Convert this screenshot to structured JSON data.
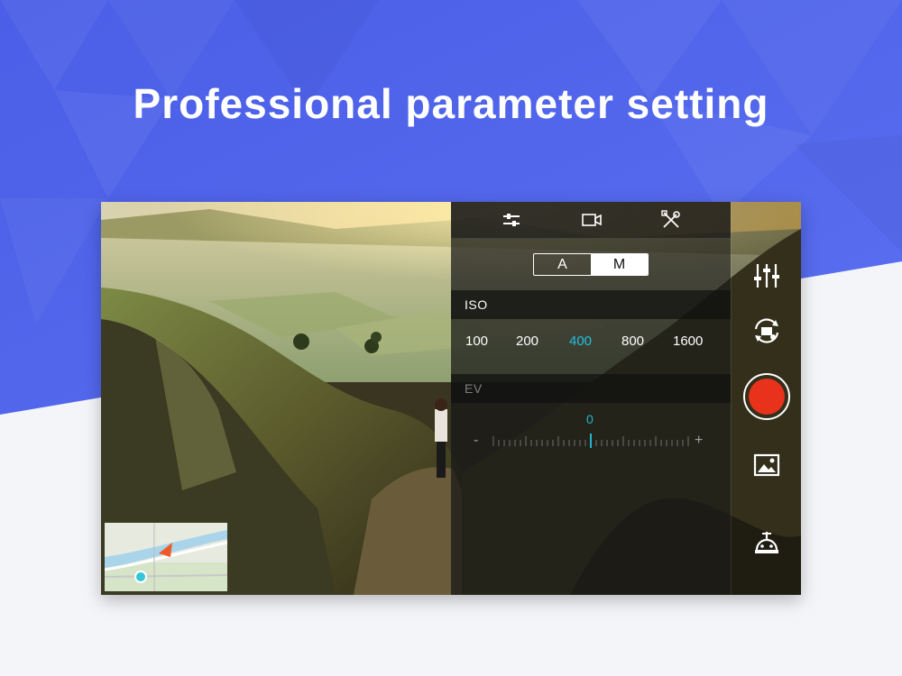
{
  "headline": "Professional parameter setting",
  "colors": {
    "accent": "#22c0e0",
    "record": "#e8321c",
    "bg_blue": "#4d62e8"
  },
  "panel": {
    "tabs": [
      {
        "icon": "sliders-icon"
      },
      {
        "icon": "video-camera-icon"
      },
      {
        "icon": "tools-icon"
      }
    ],
    "mode_toggle": {
      "a_label": "A",
      "m_label": "M",
      "selected": "M"
    },
    "iso": {
      "label": "ISO",
      "values": [
        "100",
        "200",
        "400",
        "800",
        "1600"
      ],
      "selected": "400"
    },
    "ev": {
      "label": "EV",
      "value": "0",
      "minus": "-",
      "plus": "+"
    }
  },
  "sidebar": {
    "buttons": [
      {
        "icon": "settings-sliders-icon"
      },
      {
        "icon": "switch-camera-icon"
      },
      {
        "icon": "record-button"
      },
      {
        "icon": "gallery-icon"
      },
      {
        "icon": "gimbal-icon"
      }
    ]
  }
}
